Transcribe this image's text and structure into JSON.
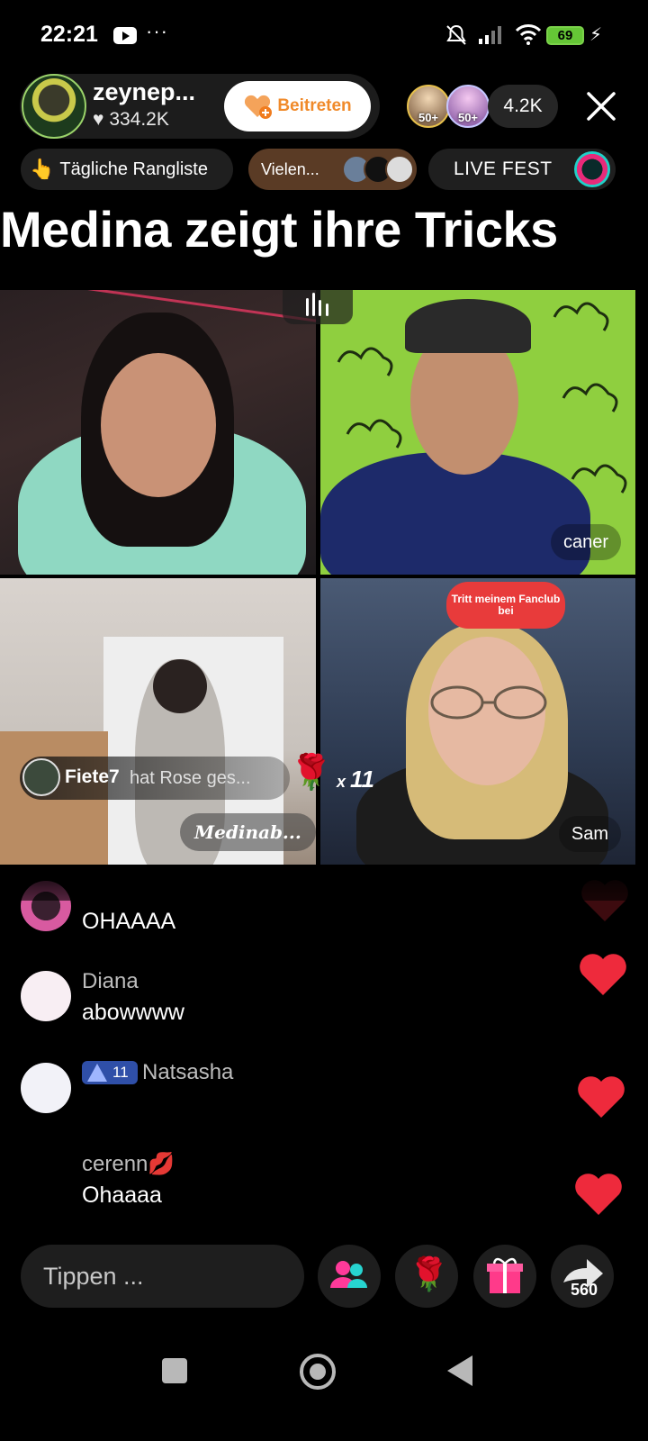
{
  "status_bar": {
    "time": "22:21",
    "overflow": "···",
    "battery": "69",
    "icons": [
      "youtube-icon",
      "bell-off-icon",
      "signal-icon",
      "wifi-icon",
      "battery-icon",
      "charging-icon"
    ]
  },
  "header": {
    "host_name": "zeynep...",
    "host_likes": "334.2K",
    "join_label": "Beitreten",
    "badge_1": "50+",
    "badge_2": "50+",
    "viewer_count": "4.2K"
  },
  "chips": {
    "ranking_label": "Tägliche Rangliste",
    "thanks_label": "Vielen...",
    "live_fest_label": "LIVE FEST"
  },
  "live_title": "Medina zeigt ihre Tricks",
  "tiles": {
    "caner_label": "caner",
    "sam_label": "Sam",
    "fanclub_text": "Tritt meinem Fanclub bei",
    "medina_label": "Medinab..."
  },
  "gift_banner": {
    "user": "Fiete7",
    "text": "hat Rose  ges...",
    "count_prefix": "x ",
    "count": "11"
  },
  "chat": [
    {
      "name": "",
      "message": "OHAAAA"
    },
    {
      "name": "Diana",
      "message": "abowwww"
    },
    {
      "name": "Natsasha",
      "level": "11",
      "message": ""
    },
    {
      "name": "cerenn💋",
      "message": "Ohaaaa"
    }
  ],
  "bottom_bar": {
    "input_placeholder": "Tippen ...",
    "share_count": "560"
  },
  "colors": {
    "accent_orange": "#f08a2a",
    "heart_red": "#ee2a3c",
    "green_screen": "#8fcf3f"
  }
}
